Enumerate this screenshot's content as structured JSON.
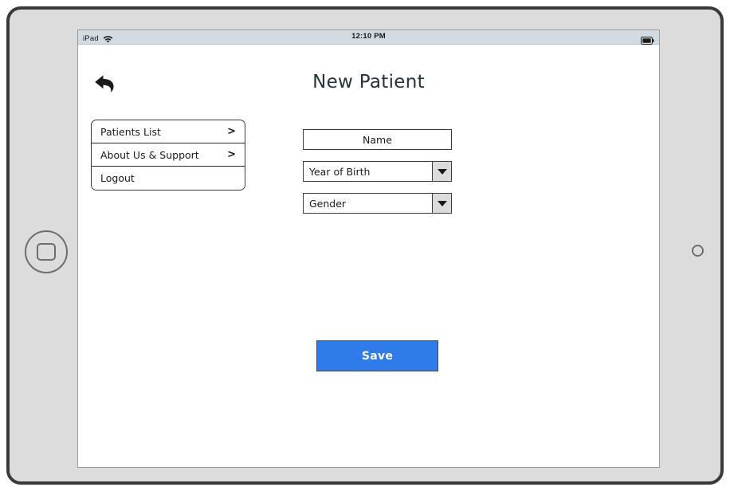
{
  "device": {
    "type": "ipad-landscape",
    "home_button_icon": "home-button-icon",
    "camera_icon": "camera-icon"
  },
  "status_bar": {
    "carrier": "iPad",
    "wifi_icon": "wifi-icon",
    "time": "12:10 PM",
    "battery_icon": "battery-icon"
  },
  "header": {
    "back_icon": "back-arrow-icon",
    "title": "New Patient"
  },
  "side_menu": {
    "items": [
      {
        "label": "Patients List",
        "chevron": ">",
        "has_chevron": true
      },
      {
        "label": "About Us & Support",
        "chevron": ">",
        "has_chevron": true
      },
      {
        "label": "Logout",
        "chevron": "",
        "has_chevron": false
      }
    ]
  },
  "form": {
    "fields": [
      {
        "name": "name",
        "value": "Name",
        "type": "text",
        "align": "center"
      },
      {
        "name": "year_of_birth",
        "value": "Year of Birth",
        "type": "select",
        "align": "left"
      },
      {
        "name": "gender",
        "value": "Gender",
        "type": "select",
        "align": "left"
      }
    ]
  },
  "actions": {
    "save_label": "Save"
  },
  "colors": {
    "accent": "#2f7bea",
    "frame": "#dcdcdc",
    "frame_border": "#3a3a3a",
    "status_bar": "#d3dbe2",
    "outline": "#3b3b3b",
    "title_text": "#26323c"
  }
}
